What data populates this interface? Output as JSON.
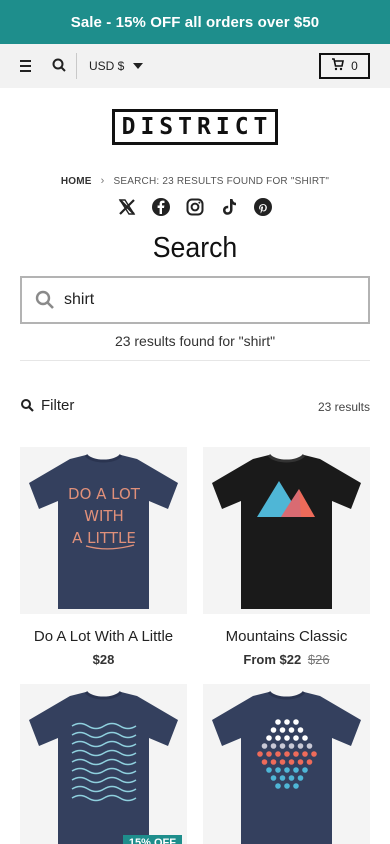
{
  "announcement": "Sale - 15% OFF all orders over $50",
  "header": {
    "currency": "USD $",
    "cart_count": "0",
    "logo_text": "DISTRICT"
  },
  "breadcrumb": {
    "home": "HOME",
    "separator": "›",
    "current": "SEARCH: 23 RESULTS FOUND FOR \"SHIRT\""
  },
  "social": [
    "x-icon",
    "facebook-icon",
    "instagram-icon",
    "tiktok-icon",
    "pinterest-icon"
  ],
  "page": {
    "title": "Search"
  },
  "search": {
    "value": "shirt",
    "result_text": "23 results found for \"shirt\""
  },
  "filter": {
    "label": "Filter",
    "count": "23 results"
  },
  "products": [
    {
      "name": "Do A Lot With A Little",
      "price": "$28",
      "old_price": "",
      "badge": ""
    },
    {
      "name": "Mountains Classic",
      "price": "From $22",
      "old_price": "$26",
      "badge": ""
    },
    {
      "name": "",
      "price": "",
      "old_price": "",
      "badge": "15% OFF"
    },
    {
      "name": "",
      "price": "",
      "old_price": "",
      "badge": ""
    }
  ],
  "shirt_graphics": {
    "p1_lines": [
      "DO A LOT",
      "WITH",
      "A LITTLE"
    ]
  },
  "colors": {
    "accent": "#1e8e8c",
    "navy_shirt": "#34405e",
    "black_shirt": "#1a1a1a"
  }
}
